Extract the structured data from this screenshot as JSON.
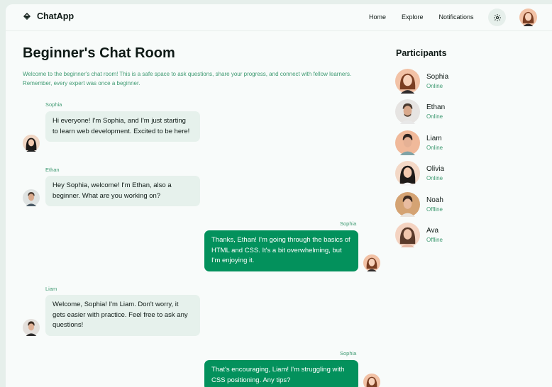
{
  "app": {
    "name": "ChatApp"
  },
  "nav": {
    "home": "Home",
    "explore": "Explore",
    "notifications": "Notifications"
  },
  "room": {
    "title": "Beginner's Chat Room",
    "description": "Welcome to the beginner's chat room! This is a safe space to ask questions, share your progress, and connect with fellow learners. Remember, every expert was once a beginner."
  },
  "messages": [
    {
      "author": "Sophia",
      "text": "Hi everyone! I'm Sophia, and I'm just starting to learn web development. Excited to be here!",
      "side": "incoming"
    },
    {
      "author": "Ethan",
      "text": "Hey Sophia, welcome! I'm Ethan, also a beginner. What are you working on?",
      "side": "incoming"
    },
    {
      "author": "Sophia",
      "text": "Thanks, Ethan! I'm going through the basics of HTML and CSS. It's a bit overwhelming, but I'm enjoying it.",
      "side": "outgoing"
    },
    {
      "author": "Liam",
      "text": "Welcome, Sophia! I'm Liam. Don't worry, it gets easier with practice. Feel free to ask any questions!",
      "side": "incoming"
    },
    {
      "author": "Sophia",
      "text": "That's encouraging, Liam! I'm struggling with CSS positioning. Any tips?",
      "side": "outgoing"
    }
  ],
  "participants_panel": {
    "title": "Participants",
    "people": [
      {
        "name": "Sophia",
        "status": "Online"
      },
      {
        "name": "Ethan",
        "status": "Online"
      },
      {
        "name": "Liam",
        "status": "Online"
      },
      {
        "name": "Olivia",
        "status": "Online"
      },
      {
        "name": "Noah",
        "status": "Offline"
      },
      {
        "name": "Ava",
        "status": "Offline"
      }
    ]
  },
  "colors": {
    "accent": "#03915c",
    "accent_text": "#3f9a72",
    "incoming_bubble": "#e6f1ec",
    "background": "#f8fbfa"
  }
}
